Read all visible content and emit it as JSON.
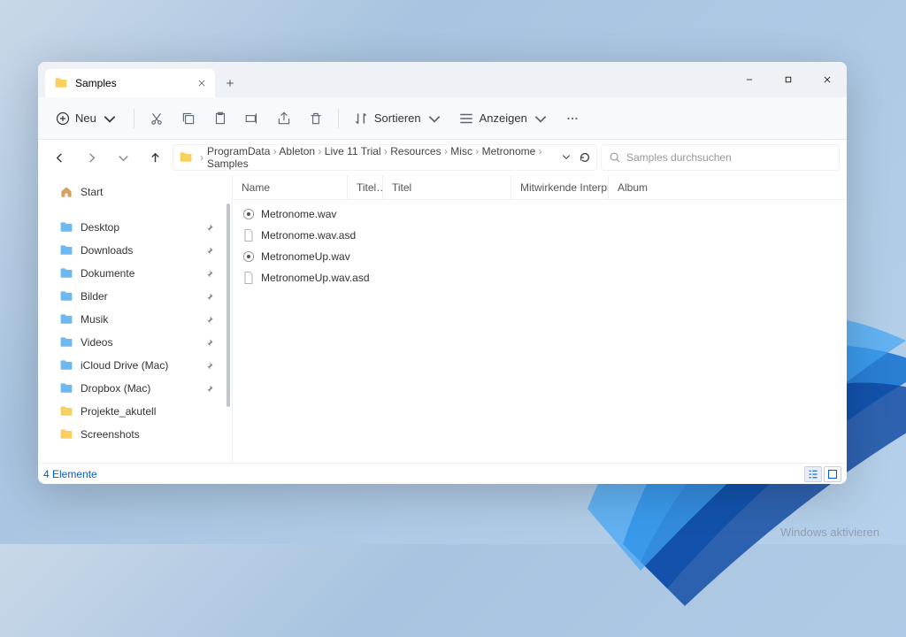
{
  "tab": {
    "title": "Samples"
  },
  "toolbar": {
    "new_label": "Neu",
    "sort_label": "Sortieren",
    "view_label": "Anzeigen"
  },
  "breadcrumbs": [
    "ProgramData",
    "Ableton",
    "Live 11 Trial",
    "Resources",
    "Misc",
    "Metronome",
    "Samples"
  ],
  "search": {
    "placeholder": "Samples durchsuchen"
  },
  "sidebar": {
    "start_label": "Start",
    "items": [
      {
        "label": "Desktop",
        "pinned": true,
        "kind": "folder"
      },
      {
        "label": "Downloads",
        "pinned": true,
        "kind": "folder"
      },
      {
        "label": "Dokumente",
        "pinned": true,
        "kind": "folder"
      },
      {
        "label": "Bilder",
        "pinned": true,
        "kind": "folder"
      },
      {
        "label": "Musik",
        "pinned": true,
        "kind": "folder"
      },
      {
        "label": "Videos",
        "pinned": true,
        "kind": "folder"
      },
      {
        "label": "iCloud Drive (Mac)",
        "pinned": true,
        "kind": "folder"
      },
      {
        "label": "Dropbox (Mac)",
        "pinned": true,
        "kind": "folder"
      },
      {
        "label": "Projekte_akutell",
        "pinned": false,
        "kind": "yellowfolder"
      },
      {
        "label": "Screenshots",
        "pinned": false,
        "kind": "yellowfolder"
      }
    ]
  },
  "columns": {
    "name": "Name",
    "titel_short": "Titel…",
    "titel": "Titel",
    "artists": "Mitwirkende Interpre…",
    "album": "Album"
  },
  "files": [
    {
      "name": "Metronome.wav",
      "kind": "wav"
    },
    {
      "name": "Metronome.wav.asd",
      "kind": "doc"
    },
    {
      "name": "MetronomeUp.wav",
      "kind": "wav"
    },
    {
      "name": "MetronomeUp.wav.asd",
      "kind": "doc"
    }
  ],
  "status": {
    "count_label": "4 Elemente"
  },
  "watermark": "Windows aktivieren"
}
